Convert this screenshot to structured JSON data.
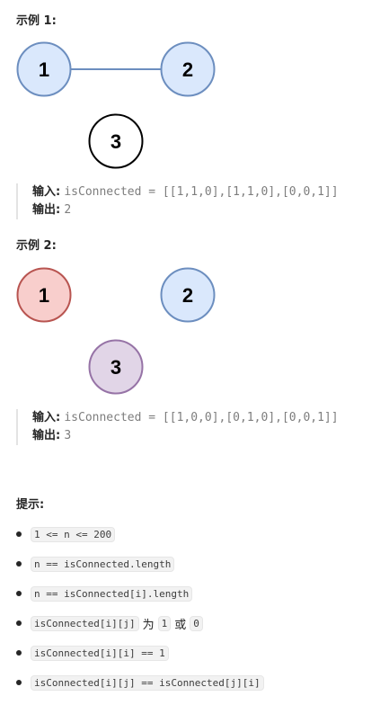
{
  "example1": {
    "heading": "示例 1:",
    "nodes": [
      "1",
      "2",
      "3"
    ],
    "input_label": "输入:",
    "input_value": "isConnected = [[1,1,0],[1,1,0],[0,0,1]]",
    "output_label": "输出:",
    "output_value": "2"
  },
  "example2": {
    "heading": "示例 2:",
    "nodes": [
      "1",
      "2",
      "3"
    ],
    "input_label": "输入:",
    "input_value": "isConnected = [[1,0,0],[0,1,0],[0,0,1]]",
    "output_label": "输出:",
    "output_value": "3"
  },
  "tips": {
    "heading": "提示:",
    "items": [
      {
        "code": "1 <= n <= 200"
      },
      {
        "code": "n == isConnected.length"
      },
      {
        "code": "n == isConnected[i].length"
      },
      {
        "code": "isConnected[i][j]",
        "text1": "为",
        "code2": "1",
        "text2": "或",
        "code3": "0"
      },
      {
        "code": "isConnected[i][i] == 1"
      },
      {
        "code": "isConnected[i][j] == isConnected[j][i]"
      }
    ]
  },
  "colors": {
    "blue_fill": "#dae8fc",
    "blue_stroke": "#6c8ebf",
    "red_fill": "#f8cecc",
    "red_stroke": "#b85450",
    "purple_fill": "#e1d5e7",
    "purple_stroke": "#9673a6",
    "white_fill": "#ffffff",
    "black_stroke": "#000000"
  }
}
